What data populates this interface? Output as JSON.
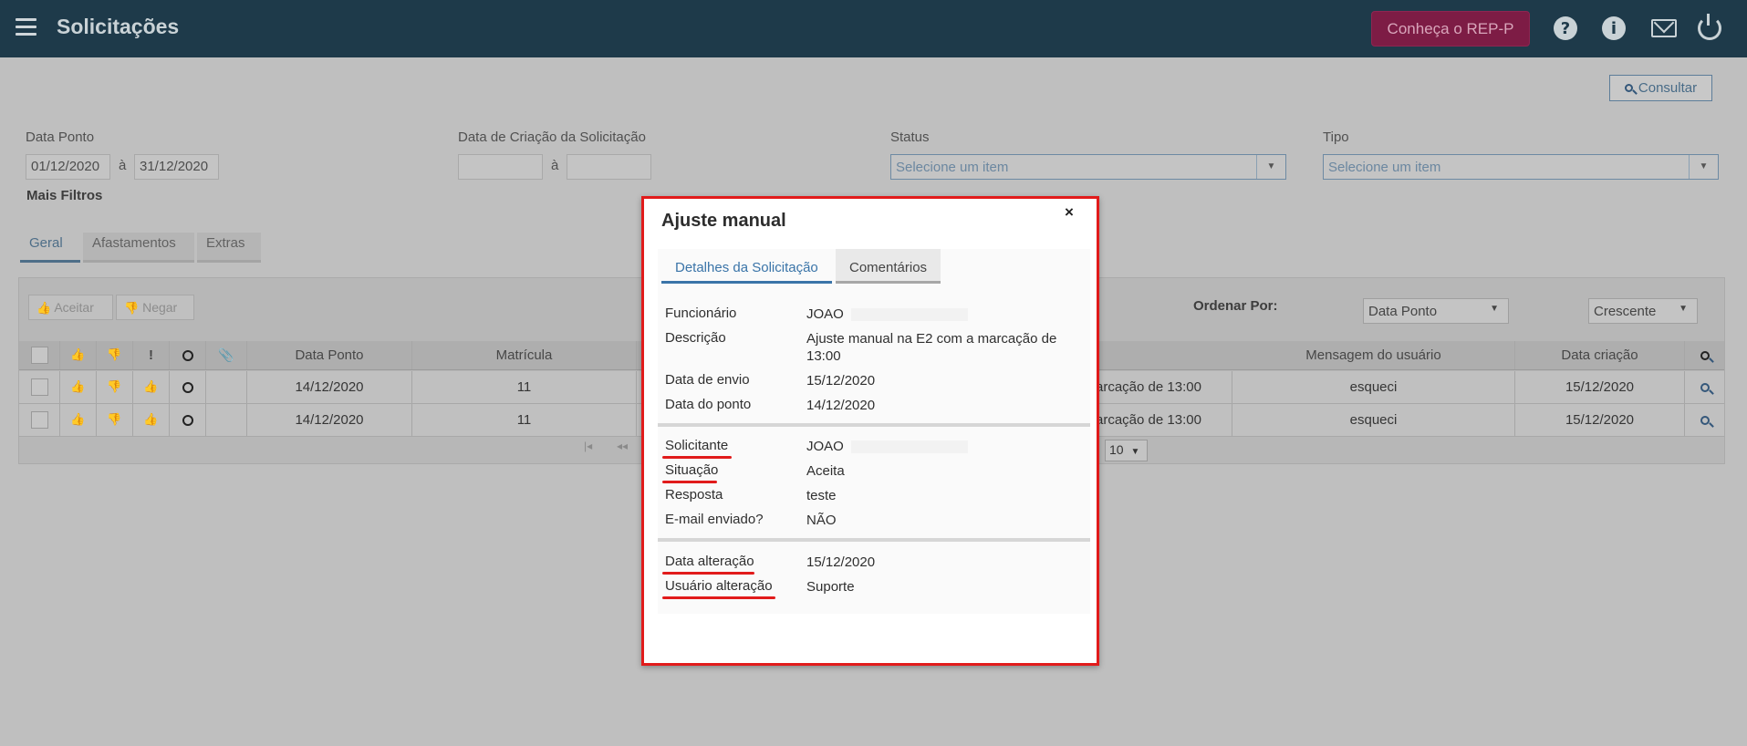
{
  "header": {
    "title": "Solicitações",
    "rep_button": "Conheça o REP-P",
    "help_icon": "?",
    "info_icon": "i"
  },
  "toolbar": {
    "consultar": "Consultar"
  },
  "filters": {
    "data_ponto_label": "Data Ponto",
    "data_ponto_from": "01/12/2020",
    "data_ponto_sep": "à",
    "data_ponto_to": "31/12/2020",
    "data_criacao_label": "Data de Criação da Solicitação",
    "data_criacao_sep": "à",
    "status_label": "Status",
    "status_placeholder": "Selecione um item",
    "tipo_label": "Tipo",
    "tipo_placeholder": "Selecione um item",
    "mais_filtros": "Mais Filtros"
  },
  "tabs": [
    "Geral",
    "Afastamentos",
    "Extras"
  ],
  "grid": {
    "aceitar": "Aceitar",
    "negar": "Negar",
    "ordenar_por": "Ordenar Por:",
    "order_field": "Data Ponto",
    "order_dir": "Crescente",
    "exclaim": "!",
    "headers": {
      "data_ponto": "Data Ponto",
      "matricula": "Matrícula",
      "mensagem": "Mensagem do usuário",
      "data_criacao": "Data criação"
    },
    "rows": [
      {
        "data_ponto": "14/12/2020",
        "matricula": "11",
        "descricao_tail": "arcação de 13:00",
        "mensagem": "esqueci",
        "data_criacao": "15/12/2020"
      },
      {
        "data_ponto": "14/12/2020",
        "matricula": "11",
        "descricao_tail": "arcação de 13:00",
        "mensagem": "esqueci",
        "data_criacao": "15/12/2020"
      }
    ],
    "page_size": "10"
  },
  "modal": {
    "title": "Ajuste manual",
    "close": "×",
    "tab_detalhes": "Detalhes da Solicitação",
    "tab_comentarios": "Comentários",
    "funcionario_label": "Funcionário",
    "funcionario_value": "JOAO",
    "descricao_label": "Descrição",
    "descricao_value": "Ajuste manual na E2 com a marcação de 13:00",
    "data_envio_label": "Data de envio",
    "data_envio_value": "15/12/2020",
    "data_ponto_label": "Data do ponto",
    "data_ponto_value": "14/12/2020",
    "solicitante_label": "Solicitante",
    "solicitante_value": "JOAO",
    "situacao_label": "Situação",
    "situacao_value": "Aceita",
    "resposta_label": "Resposta",
    "resposta_value": "teste",
    "email_label": "E-mail enviado?",
    "email_value": "NÃO",
    "data_alteracao_label": "Data alteração",
    "data_alteracao_value": "15/12/2020",
    "usuario_alteracao_label": "Usuário alteração",
    "usuario_alteracao_value": "Suporte"
  }
}
